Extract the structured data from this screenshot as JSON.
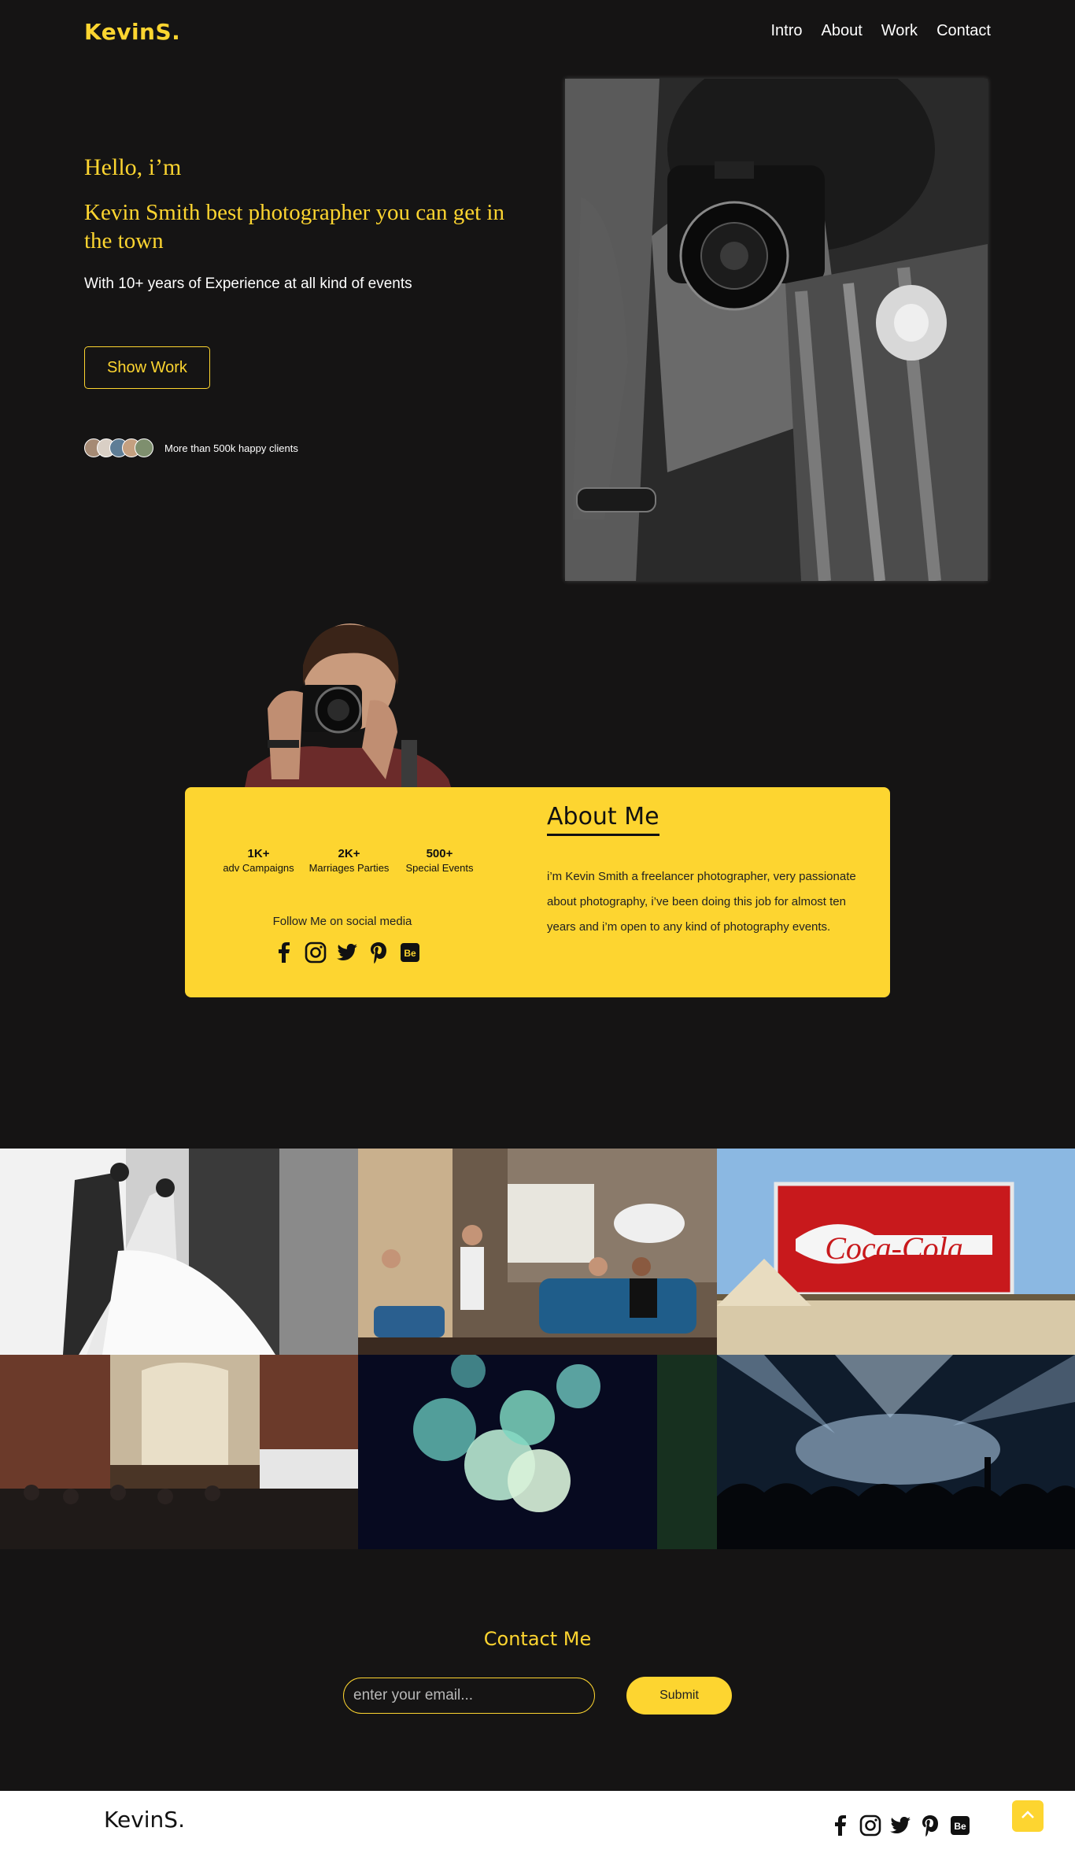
{
  "nav": {
    "logo": "KevinS.",
    "links": [
      "Intro",
      "About",
      "Work",
      "Contact"
    ]
  },
  "hero": {
    "hello": "Hello, i’m",
    "title": "Kevin Smith best photographer you can get in the town",
    "subtitle": "With 10+ years of Experience at all kind of events",
    "button": "Show Work",
    "clients_text": "More than 500k happy clients"
  },
  "about": {
    "title": "About Me",
    "stats": [
      {
        "num": "1K+",
        "label": "adv Campaigns"
      },
      {
        "num": "2K+",
        "label": "Marriages Parties"
      },
      {
        "num": "500+",
        "label": "Special Events"
      }
    ],
    "follow": "Follow Me on social media",
    "text": "i’m Kevin Smith a freelancer photographer, very passionate about photography, i’ve been doing this job for almost ten years and i’m open to any kind of photography events."
  },
  "contact": {
    "title": "Contact Me",
    "email_placeholder": "enter your email...",
    "submit": "Submit"
  },
  "footer": {
    "logo": "KevinS."
  },
  "social_icons": [
    "facebook-icon",
    "instagram-icon",
    "twitter-icon",
    "pinterest-icon",
    "behance-icon"
  ],
  "colors": {
    "accent": "#fdd530",
    "background": "#151414"
  }
}
